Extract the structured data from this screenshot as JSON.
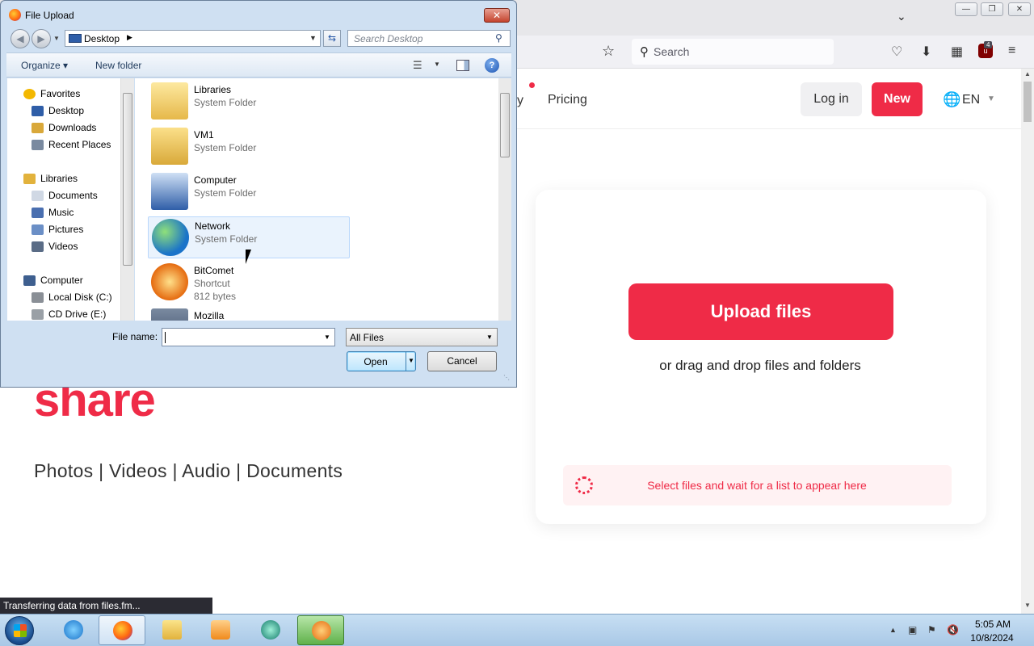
{
  "browser": {
    "search_placeholder": "Search",
    "ublock_count": "4"
  },
  "page": {
    "nav_partial": "y",
    "nav_pricing": "Pricing",
    "login_label": "Log in",
    "new_label": "New",
    "lang_label": "EN",
    "hero_word": "share",
    "hero_types": "Photos | Videos | Audio | Documents",
    "upload_button": "Upload files",
    "drag_text": "or drag and drop files and folders",
    "status_text": "Select files and wait for a list to appear here",
    "transfer_status": "Transferring data from files.fm..."
  },
  "dialog": {
    "title": "File Upload",
    "address": "Desktop",
    "search_placeholder": "Search Desktop",
    "organize_label": "Organize",
    "new_folder_label": "New folder",
    "nav_pane": [
      {
        "label": "Favorites",
        "icon": "star-icon"
      },
      {
        "label": "Desktop",
        "icon": "desktop-icon"
      },
      {
        "label": "Downloads",
        "icon": "downloads-folder-icon"
      },
      {
        "label": "Recent Places",
        "icon": "recent-places-icon"
      },
      {
        "label": "Libraries",
        "icon": "libraries-icon"
      },
      {
        "label": "Documents",
        "icon": "documents-icon"
      },
      {
        "label": "Music",
        "icon": "music-icon"
      },
      {
        "label": "Pictures",
        "icon": "pictures-icon"
      },
      {
        "label": "Videos",
        "icon": "videos-icon"
      },
      {
        "label": "Computer",
        "icon": "computer-icon"
      },
      {
        "label": "Local Disk (C:)",
        "icon": "local-disk-icon"
      },
      {
        "label": "CD Drive (E:)",
        "icon": "cd-drive-icon"
      }
    ],
    "files": [
      {
        "name": "Libraries",
        "type": "System Folder",
        "size": ""
      },
      {
        "name": "VM1",
        "type": "System Folder",
        "size": ""
      },
      {
        "name": "Computer",
        "type": "System Folder",
        "size": ""
      },
      {
        "name": "Network",
        "type": "System Folder",
        "size": ""
      },
      {
        "name": "BitComet",
        "type": "Shortcut",
        "size": "812 bytes"
      },
      {
        "name": "Mozilla",
        "type": "",
        "size": ""
      }
    ],
    "filename_label": "File name:",
    "filename_value": "",
    "filter_value": "All Files",
    "open_label": "Open",
    "cancel_label": "Cancel"
  },
  "taskbar": {
    "clock_time": "5:05 AM",
    "clock_date": "10/8/2024",
    "apps": [
      "internet-explorer",
      "firefox",
      "file-explorer",
      "media-player",
      "teamviewer",
      "bitcomet"
    ]
  }
}
